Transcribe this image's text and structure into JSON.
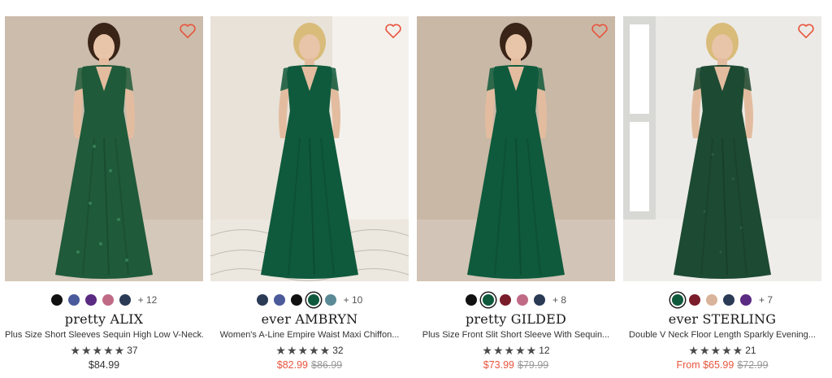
{
  "products": [
    {
      "brand": "pretty ALIX",
      "title": "Plus Size Short Sleeves Sequin High Low V-Neck...",
      "rating_count": "37",
      "stars": 5,
      "price": "$84.99",
      "original_price": "",
      "on_sale": false,
      "swatches": [
        "#111111",
        "#4b5a9a",
        "#5b2a82",
        "#c06b86",
        "#2b3a55"
      ],
      "selected_swatch": -1,
      "more_colors": "+ 12",
      "dress_color": "#1f5a3a",
      "bg_color": "#cbbcab"
    },
    {
      "brand": "ever AMBRYN",
      "title": "Women's A-Line Empire Waist Maxi Chiffon...",
      "rating_count": "32",
      "stars": 5,
      "price": "$82.99",
      "original_price": "$86.99",
      "on_sale": true,
      "swatches": [
        "#2b3a55",
        "#4b5a9a",
        "#111111",
        "#0f5a3c",
        "#5a8a96"
      ],
      "selected_swatch": 3,
      "more_colors": "+ 10",
      "dress_color": "#0f5a3c",
      "bg_color": "#e8e2d8"
    },
    {
      "brand": "pretty GILDED",
      "title": "Plus Size Front Slit Short Sleeve With Sequin...",
      "rating_count": "12",
      "stars": 5,
      "price": "$73.99",
      "original_price": "$79.99",
      "on_sale": true,
      "swatches": [
        "#111111",
        "#0f5a3c",
        "#7a1c2a",
        "#c06b86",
        "#2b3a55"
      ],
      "selected_swatch": 1,
      "more_colors": "+ 8",
      "dress_color": "#0f5a3c",
      "bg_color": "#c9b8a6"
    },
    {
      "brand": "ever STERLING",
      "title": "Double V Neck Floor Length Sparkly Evening...",
      "rating_count": "21",
      "stars": 5,
      "price": "From $65.99",
      "original_price": "$72.99",
      "on_sale": true,
      "swatches": [
        "#0f5a3c",
        "#7a1c2a",
        "#d9b49a",
        "#2b3a55",
        "#5b2a82"
      ],
      "selected_swatch": 0,
      "more_colors": "+ 7",
      "dress_color": "#1d4a32",
      "bg_color": "#eceae6"
    }
  ],
  "icons": {
    "wishlist": "heart-outline-icon",
    "star": "star-icon"
  },
  "colors": {
    "accent_sale": "#e8553e",
    "heart": "#e8553e"
  }
}
